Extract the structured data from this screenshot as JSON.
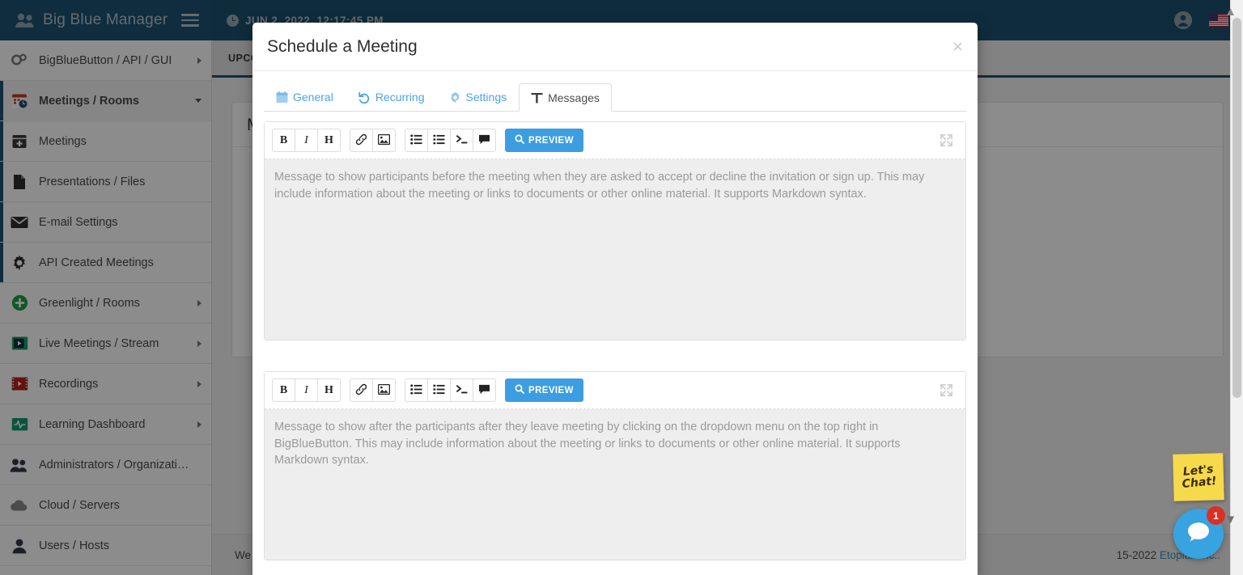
{
  "navbar": {
    "brand": "Big Blue Manager",
    "brand_icon": "users-icon",
    "menu_toggle_icon": "hamburger-icon",
    "clock_icon": "clock-icon",
    "datetime": "JUN 2, 2022, 12:17:45 PM",
    "user_icon": "user-circle-icon",
    "language_flag": "us-flag-icon"
  },
  "sidebar": {
    "items": [
      {
        "label": "BigBlueButton / API / GUI",
        "icon": "gears-icon",
        "caret": "right"
      },
      {
        "label": "Meetings / Rooms",
        "icon": "calendar-clock-icon",
        "caret": "down",
        "active": true
      },
      {
        "label": "Meetings",
        "icon": "calendar-plus-icon",
        "caret": "",
        "sub": true
      },
      {
        "label": "Presentations / Files",
        "icon": "file-icon",
        "caret": "",
        "sub": true
      },
      {
        "label": "E-mail Settings",
        "icon": "envelope-icon",
        "caret": "",
        "sub": true
      },
      {
        "label": "API Created Meetings",
        "icon": "gear-icon",
        "caret": "",
        "sub": true
      },
      {
        "label": "Greenlight / Rooms",
        "icon": "plus-circle-icon",
        "caret": "right"
      },
      {
        "label": "Live Meetings / Stream",
        "icon": "video-play-icon",
        "caret": "right"
      },
      {
        "label": "Recordings",
        "icon": "film-icon",
        "caret": "right"
      },
      {
        "label": "Learning Dashboard",
        "icon": "pulse-icon",
        "caret": "right"
      },
      {
        "label": "Administrators / Organizati…",
        "icon": "users-group-icon",
        "caret": ""
      },
      {
        "label": "Cloud / Servers",
        "icon": "cloud-icon",
        "caret": ""
      },
      {
        "label": "Users / Hosts",
        "icon": "user-icon",
        "caret": ""
      }
    ]
  },
  "content": {
    "tab_label": "UPCOMING",
    "panel_title": "M",
    "footer_left": "We",
    "footer_right_text": "15-2022 ",
    "footer_right_link": "Etopian Inc.."
  },
  "modal": {
    "title": "Schedule a Meeting",
    "close_icon": "close-icon",
    "close_label": "×",
    "tabs": [
      {
        "label": "General",
        "icon": "calendar-icon",
        "active": false
      },
      {
        "label": "Recurring",
        "icon": "repeat-icon",
        "active": false
      },
      {
        "label": "Settings",
        "icon": "gear-icon",
        "active": false
      },
      {
        "label": "Messages",
        "icon": "text-icon",
        "active": true
      }
    ],
    "editors": [
      {
        "name": "welcome-message-editor",
        "placeholder": "Message to show participants before the meeting when they are asked to accept or decline the invitation or sign up. This may include information about the meeting or links to documents or other online material. It supports Markdown syntax.",
        "value": ""
      },
      {
        "name": "exit-message-editor",
        "placeholder": "Message to show after the participants after they leave meeting by clicking on the dropdown menu on the top right in BigBlueButton. This may include information about the meeting or links to documents or other online material. It supports Markdown syntax.",
        "value": ""
      }
    ],
    "toolbar": {
      "bold_label": "B",
      "italic_label": "I",
      "heading_label": "H",
      "link_icon": "link-icon",
      "image_icon": "image-icon",
      "unordered_list_icon": "unordered-list-icon",
      "ordered_list_icon": "ordered-list-icon",
      "code_icon": "terminal-code-icon",
      "quote_icon": "quote-icon",
      "preview_label": "PREVIEW",
      "preview_icon": "search-icon",
      "expand_icon": "expand-fullscreen-icon"
    }
  },
  "chat": {
    "note_line1": "Let's",
    "note_line2": "Chat!",
    "bubble_icon": "chat-bubble-icon",
    "unread_count": "1"
  },
  "colors": {
    "navbar": "#1c506f",
    "accent_blue": "#3c9ee0",
    "tab_link": "#4aa3e8",
    "note_yellow": "#f7d94c",
    "badge_red": "#d93025"
  }
}
